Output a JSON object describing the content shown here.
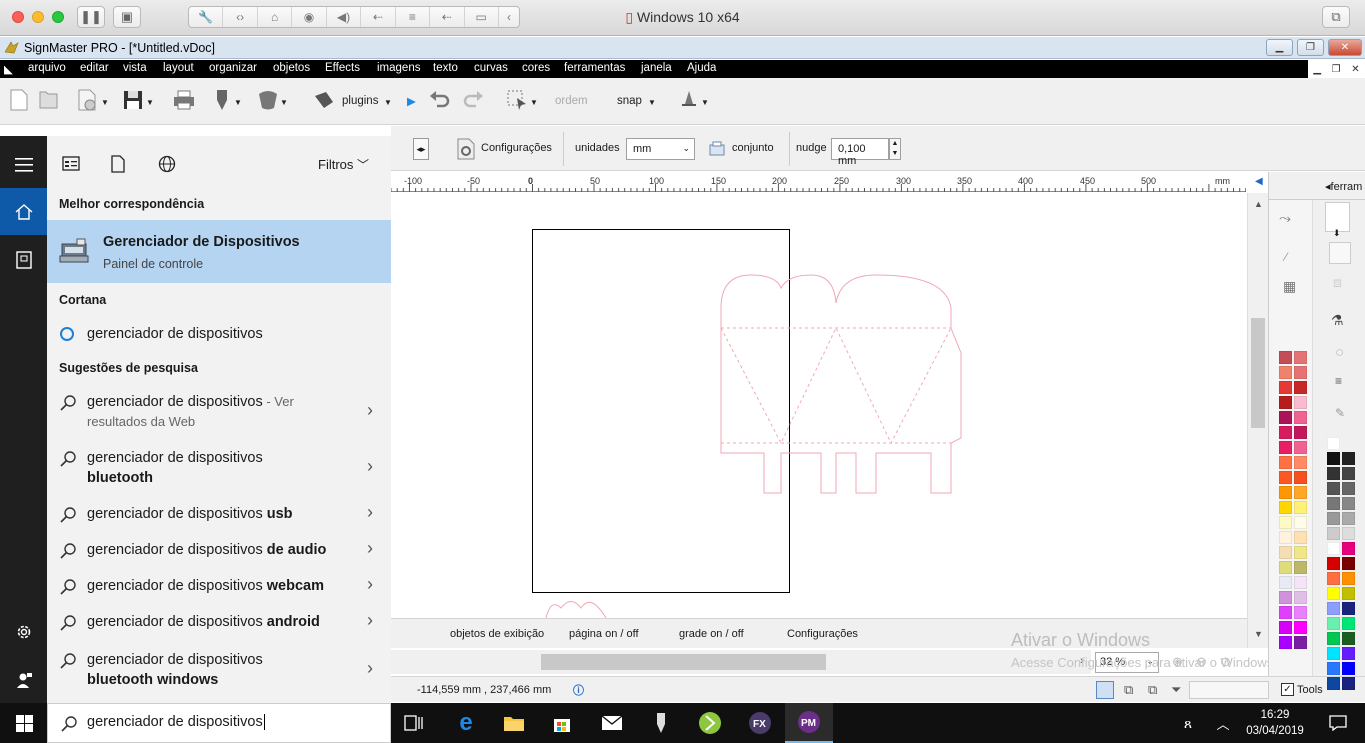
{
  "mac": {
    "title": "Windows 10 x64"
  },
  "app": {
    "title": "SignMaster PRO - [*Untitled.vDoc]",
    "menu": [
      "arquivo",
      "editar",
      "vista",
      "layout",
      "organizar",
      "objetos",
      "Effects",
      "imagens",
      "texto",
      "curvas",
      "cores",
      "ferramentas",
      "janela",
      "Ajuda"
    ]
  },
  "toolbar": {
    "plugins": "plugins",
    "ordem": "ordem",
    "snap": "snap"
  },
  "propbar": {
    "configuracoes": "Configurações",
    "unidades_label": "unidades",
    "unidades_value": "mm",
    "conjunto": "conjunto",
    "nudge_label": "nudge",
    "nudge_value": "0,100 mm"
  },
  "ruler": {
    "ticks": [
      "-100",
      "-50",
      "0",
      "50",
      "100",
      "150",
      "200",
      "250",
      "300",
      "350",
      "400",
      "450",
      "500"
    ],
    "unit": "mm"
  },
  "right_panel": {
    "tab": "ferram"
  },
  "bottom_tabs": [
    "objetos de exibição",
    "página on / off",
    "grade on / off",
    "Configurações"
  ],
  "status": {
    "coords": "-114,559 mm , 237,466 mm",
    "zoom": "32 %",
    "tools": "Tools"
  },
  "watermark": {
    "line1": "Ativar o Windows",
    "line2": "Acesse Configurações para ativar o Windows."
  },
  "start": {
    "filter_label": "Filtros",
    "best_match_heading": "Melhor correspondência",
    "best_match": {
      "title": "Gerenciador de Dispositivos",
      "subtitle": "Painel de controle"
    },
    "cortana_heading": "Cortana",
    "cortana_item": "gerenciador de dispositivos",
    "suggestions_heading": "Sugestões de pesquisa",
    "suggestions": [
      {
        "base": "gerenciador de dispositivos",
        "bold": "",
        "extra": " - Ver",
        "line2": "resultados da Web"
      },
      {
        "base": "gerenciador de dispositivos",
        "bold": "",
        "extra": "",
        "line2": "bluetooth"
      },
      {
        "base": "gerenciador de dispositivos ",
        "bold": "usb",
        "extra": "",
        "line2": ""
      },
      {
        "base": "gerenciador de dispositivos ",
        "bold": "de audio",
        "extra": "",
        "line2": ""
      },
      {
        "base": "gerenciador de dispositivos ",
        "bold": "webcam",
        "extra": "",
        "line2": ""
      },
      {
        "base": "gerenciador de dispositivos ",
        "bold": "android",
        "extra": "",
        "line2": ""
      },
      {
        "base": "gerenciador de dispositivos",
        "bold": "",
        "extra": "",
        "line2": "bluetooth windows"
      }
    ],
    "search_value": "gerenciador de dispositivos"
  },
  "taskbar": {
    "time": "16:29",
    "date": "03/04/2019"
  }
}
